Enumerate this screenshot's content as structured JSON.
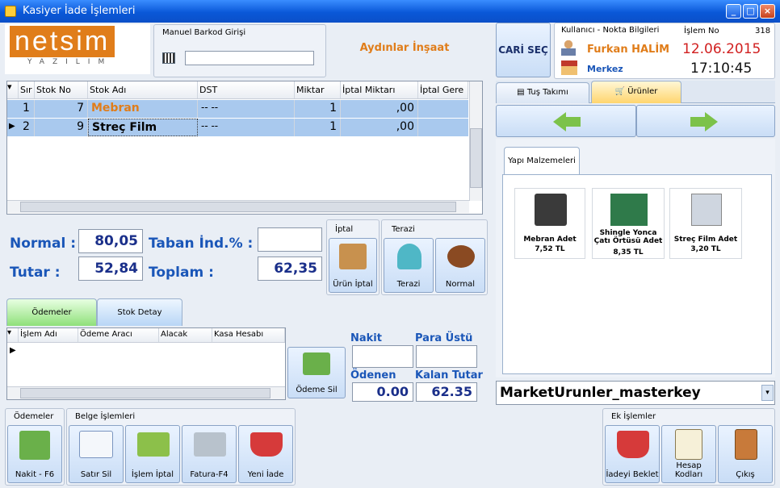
{
  "window": {
    "title": "Kasiyer İade İşlemleri"
  },
  "logo": {
    "brand": "netsim",
    "sub": "YAZILIM"
  },
  "barcode": {
    "label": "Manuel Barkod Girişi",
    "value": ""
  },
  "company": "Aydınlar İnşaat",
  "cari_button": "CARİ SEÇ",
  "user_info": {
    "header": "Kullanıcı - Nokta Bilgileri",
    "islem_label": "İşlem No",
    "islem_no": "318",
    "user": "Furkan HALİM",
    "location": "Merkez",
    "date": "12.06.2015",
    "time": "17:10:45"
  },
  "grid": {
    "columns": [
      "Sır",
      "Stok No",
      "Stok Adı",
      "DST",
      "Miktar",
      "İptal Miktarı",
      "İptal Gere"
    ],
    "rows": [
      {
        "sira": "1",
        "stok_no": "7",
        "stok_adi": "Mebran",
        "dst": "-- --",
        "miktar": "1",
        "iptal": ",00"
      },
      {
        "sira": "2",
        "stok_no": "9",
        "stok_adi": "Streç Film",
        "dst": "-- --",
        "miktar": "1",
        "iptal": ",00"
      }
    ]
  },
  "totals": {
    "normal_label": "Normal :",
    "normal": "80,05",
    "tutar_label": "Tutar :",
    "tutar": "52,84",
    "taban_label": "Taban İnd.% :",
    "taban": "",
    "toplam_label": "Toplam :",
    "toplam": "62,35"
  },
  "iptal_group": {
    "title": "İptal",
    "button": "Ürün İptal"
  },
  "terazi_group": {
    "title": "Terazi",
    "terazi": "Terazi",
    "normal": "Normal"
  },
  "payment_tabs": {
    "odemeler": "Ödemeler",
    "stok_detay": "Stok Detay"
  },
  "payment_grid": {
    "columns": [
      "İşlem Adı",
      "Ödeme Aracı",
      "Alacak",
      "Kasa Hesabı"
    ]
  },
  "odeme_sil": "Ödeme Sil",
  "payment_summary": {
    "nakit": "Nakit",
    "para_ustu": "Para Üstü",
    "odenen": "Ödenen",
    "odenen_val": "0.00",
    "kalan": "Kalan Tutar",
    "kalan_val": "62.35"
  },
  "right_tabs": {
    "tus": "Tuş Takımı",
    "urunler": "Ürünler"
  },
  "category_tab": "Yapı Malzemeleri",
  "products": [
    {
      "name": "Mebran Adet",
      "price": "7,52 TL",
      "color": "#3a3a3a"
    },
    {
      "name": "Shingle Yonca Çatı Örtüsü Adet",
      "price": "8,35 TL",
      "color": "#2f7a4a"
    },
    {
      "name": "Streç Film Adet",
      "price": "3,20 TL",
      "color": "#cfd6e0"
    }
  ],
  "product_select": "MarketUrunler_masterkey",
  "bottom": {
    "odemeler_group": "Ödemeler",
    "nakit": "Nakit - F6",
    "belge_group": "Belge İşlemleri",
    "satir_sil": "Satır Sil",
    "islem_iptal": "İşlem İptal",
    "fatura": "Fatura-F4",
    "yeni_iade": "Yeni İade",
    "ek_group": "Ek İşlemler",
    "iadeyi_beklet": "İadeyi Beklet",
    "hesap_kodlari": "Hesap Kodları",
    "cikis": "Çıkış"
  }
}
